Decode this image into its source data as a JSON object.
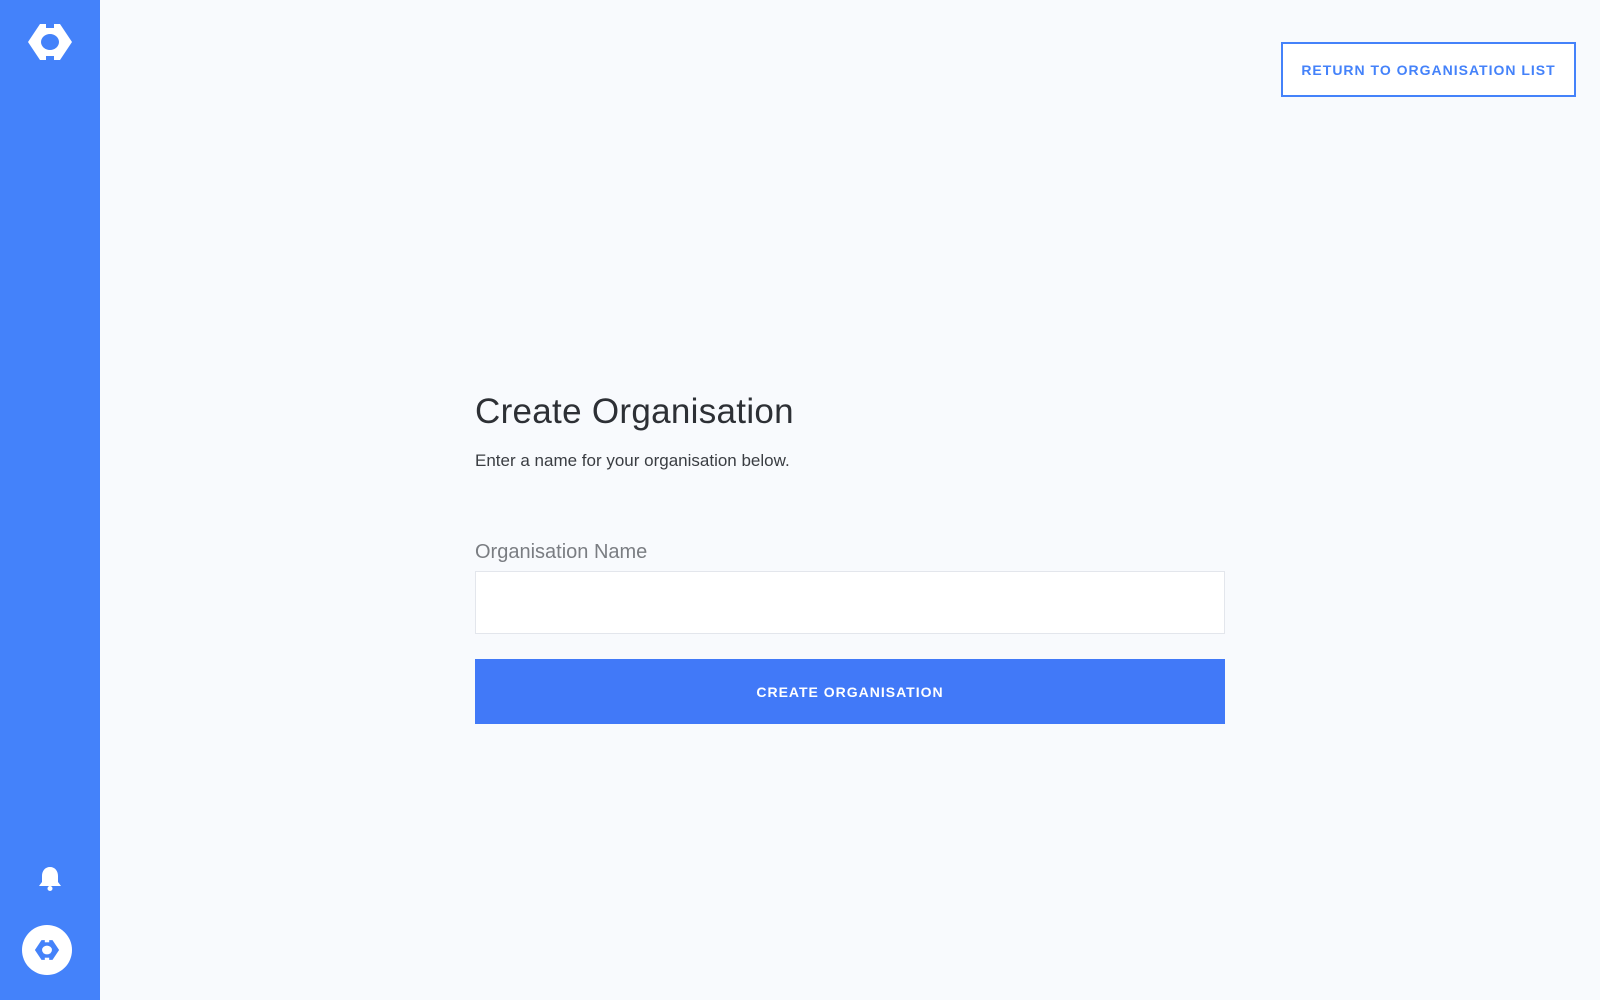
{
  "sidebar": {
    "logo_icon": "organisation-logo-icon",
    "notification_icon": "bell-icon",
    "avatar_icon": "organisation-logo-icon"
  },
  "header": {
    "return_label": "RETURN TO ORGANISATION LIST"
  },
  "form": {
    "title": "Create Organisation",
    "subtitle": "Enter a name for your organisation below.",
    "name_label": "Organisation Name",
    "name_value": "",
    "submit_label": "CREATE ORGANISATION"
  },
  "colors": {
    "accent": "#4482fa",
    "background": "#f8fafd"
  }
}
